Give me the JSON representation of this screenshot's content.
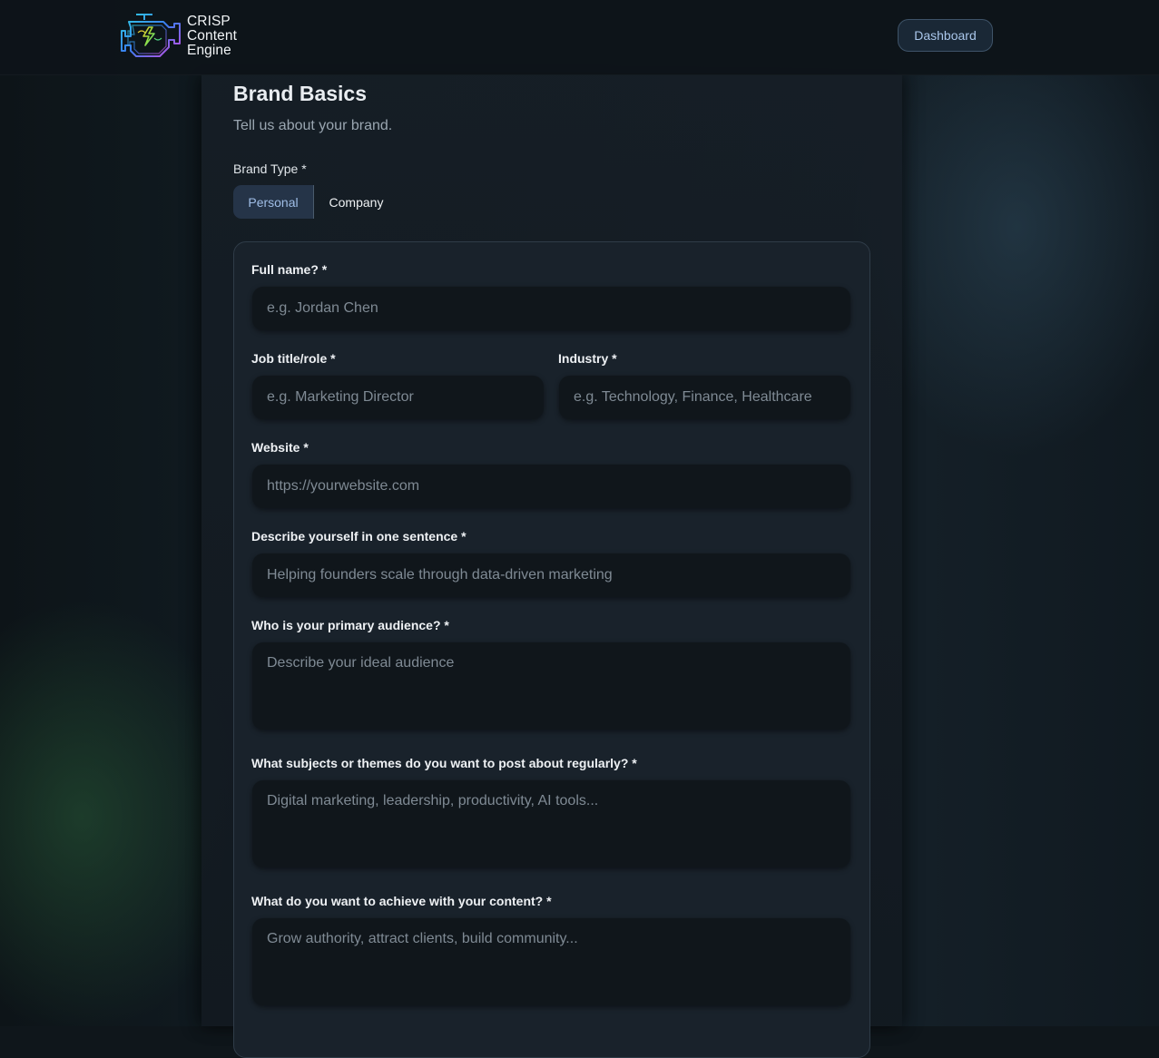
{
  "header": {
    "logo_lines": [
      "CRISP",
      "Content",
      "Engine"
    ],
    "dashboard_button": "Dashboard"
  },
  "page": {
    "title": "Brand Basics",
    "subtitle": "Tell us about your brand."
  },
  "brand_type": {
    "label": "Brand Type *",
    "options": [
      "Personal",
      "Company"
    ],
    "selected": "Personal"
  },
  "form": {
    "full_name": {
      "label": "Full name? *",
      "placeholder": "e.g. Jordan Chen"
    },
    "job_title": {
      "label": "Job title/role *",
      "placeholder": "e.g. Marketing Director"
    },
    "industry": {
      "label": "Industry *",
      "placeholder": "e.g. Technology, Finance, Healthcare"
    },
    "website": {
      "label": "Website *",
      "placeholder": "https://yourwebsite.com"
    },
    "one_sentence": {
      "label": "Describe yourself in one sentence *",
      "placeholder": "Helping founders scale through data-driven marketing"
    },
    "audience": {
      "label": "Who is your primary audience? *",
      "placeholder": "Describe your ideal audience"
    },
    "themes": {
      "label": "What subjects or themes do you want to post about regularly? *",
      "placeholder": "Digital marketing, leadership, productivity, AI tools..."
    },
    "goals": {
      "label": "What do you want to achieve with your content? *",
      "placeholder": "Grow authority, attract clients, build community..."
    }
  },
  "colors": {
    "accent": "#9fbde6",
    "background": "#0f161b",
    "card": "#19222b",
    "field": "#10161b"
  }
}
